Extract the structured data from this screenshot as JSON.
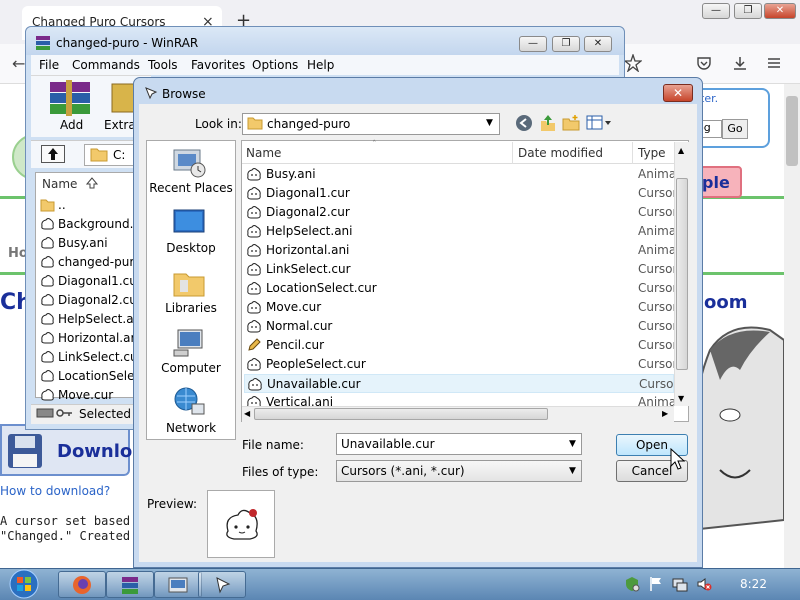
{
  "firefox": {
    "tab_title": "Changed Puro Cursors",
    "tab_close": "×",
    "new_tab": "+",
    "page": {
      "search_link": "ter.",
      "search_input": "og",
      "go_button": "Go",
      "ple_text": "ple",
      "oom_text": "oom",
      "ho_text": "Ho",
      "ch_text": "Ch",
      "download_label": "Download",
      "how_to_download": "How to download?",
      "desc_line1": "A cursor set based o",
      "desc_line2": "\"Changed.\" Created us"
    }
  },
  "winrar": {
    "title": "changed-puro - WinRAR",
    "menu": [
      "File",
      "Commands",
      "Tools",
      "Favorites",
      "Options",
      "Help"
    ],
    "toolbar": {
      "add": "Add",
      "extract": "Extra"
    },
    "path": "C:",
    "column_name": "Name",
    "files": [
      "..",
      "Background.",
      "Busy.ani",
      "changed-pur",
      "Diagonal1.cu",
      "Diagonal2.cu",
      "HelpSelect.ar",
      "Horizontal.ar",
      "LinkSelect.cu",
      "LocationSele",
      "Move.cur"
    ],
    "status": "Selected"
  },
  "browse": {
    "title": "Browse",
    "close": "✕",
    "look_in_label": "Look in:",
    "look_in_value": "changed-puro",
    "places": [
      "Recent Places",
      "Desktop",
      "Libraries",
      "Computer",
      "Network"
    ],
    "columns": {
      "name": "Name",
      "date_modified": "Date modified",
      "type": "Type"
    },
    "files": [
      {
        "name": "Busy.ani",
        "type": "Anima"
      },
      {
        "name": "Diagonal1.cur",
        "type": "Cursor"
      },
      {
        "name": "Diagonal2.cur",
        "type": "Cursor"
      },
      {
        "name": "HelpSelect.ani",
        "type": "Anima"
      },
      {
        "name": "Horizontal.ani",
        "type": "Anima"
      },
      {
        "name": "LinkSelect.cur",
        "type": "Cursor"
      },
      {
        "name": "LocationSelect.cur",
        "type": "Cursor"
      },
      {
        "name": "Move.cur",
        "type": "Cursor"
      },
      {
        "name": "Normal.cur",
        "type": "Cursor"
      },
      {
        "name": "Pencil.cur",
        "type": "Cursor"
      },
      {
        "name": "PeopleSelect.cur",
        "type": "Cursor"
      },
      {
        "name": "Unavailable.cur",
        "type": "Cursor"
      },
      {
        "name": "Vertical.ani",
        "type": "Anima"
      }
    ],
    "selected_index": 11,
    "file_name_label": "File name:",
    "file_name_value": "Unavailable.cur",
    "files_of_type_label": "Files of type:",
    "files_of_type_value": "Cursors (*.ani, *.cur)",
    "open_button": "Open",
    "cancel_button": "Cancel",
    "preview_label": "Preview:"
  },
  "taskbar": {
    "clock": "8:22"
  },
  "colors": {
    "accent": "#3c7fb1",
    "selection": "#e5f3fb",
    "link": "#2b64c8",
    "page_heading": "#1a2f9a"
  }
}
